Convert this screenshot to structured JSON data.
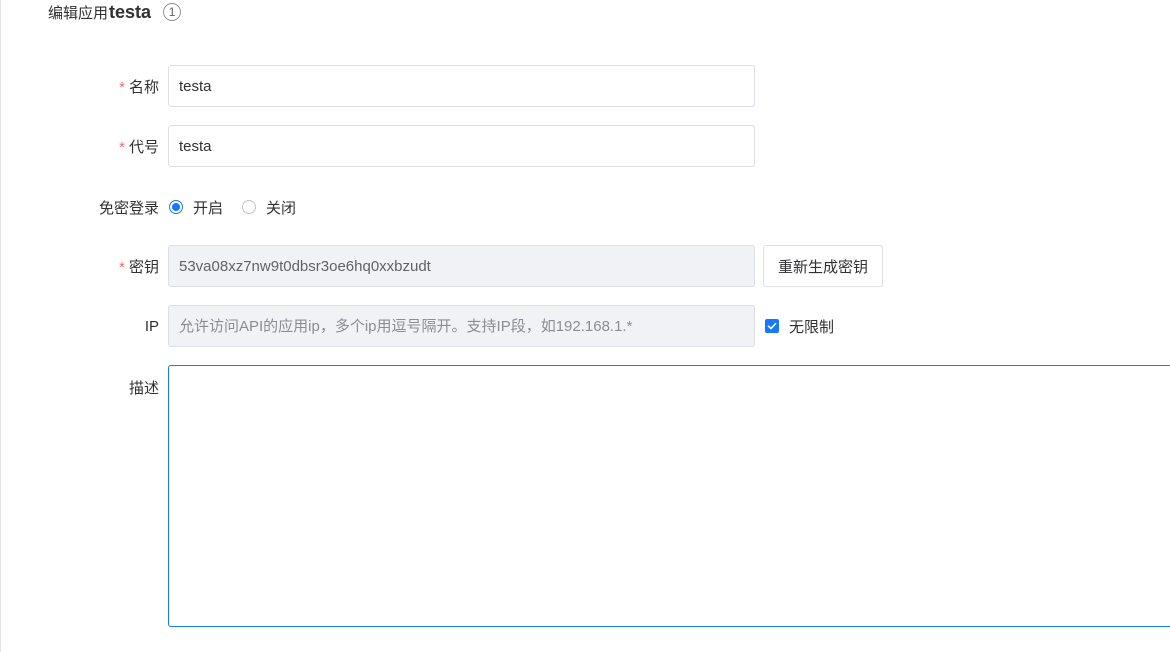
{
  "header": {
    "prefix": "编辑应用",
    "app_name": "testa",
    "badge": "1"
  },
  "form": {
    "name": {
      "label": "名称",
      "required_mark": "*",
      "value": "testa"
    },
    "code": {
      "label": "代号",
      "required_mark": "*",
      "value": "testa"
    },
    "passwordless_login": {
      "label": "免密登录",
      "options": [
        {
          "label": "开启",
          "checked": true
        },
        {
          "label": "关闭",
          "checked": false
        }
      ]
    },
    "secret": {
      "label": "密钥",
      "required_mark": "*",
      "value": "53va08xz7nw9t0dbsr3oe6hq0xxbzudt",
      "regenerate_button": "重新生成密钥"
    },
    "ip": {
      "label": "IP",
      "placeholder": "允许访问API的应用ip，多个ip用逗号隔开。支持IP段，如192.168.1.*",
      "unlimited_label": "无限制",
      "unlimited_checked": true
    },
    "description": {
      "label": "描述",
      "value": ""
    }
  },
  "colors": {
    "accent": "#1677ff",
    "required": "#f56c6c",
    "disabled_bg": "#f0f2f5"
  }
}
